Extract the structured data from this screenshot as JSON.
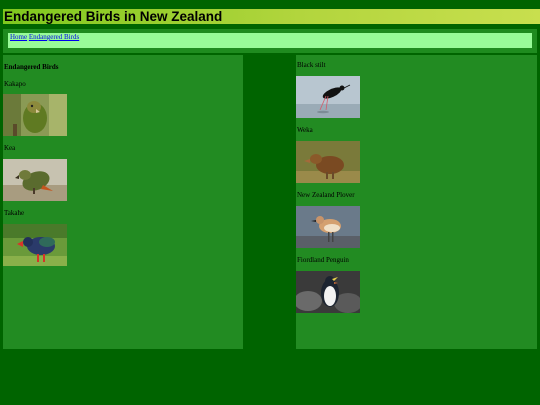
{
  "page": {
    "title": "Endangered Birds in New Zealand"
  },
  "breadcrumb": {
    "home": "Home",
    "current": "Endangered Birds"
  },
  "left_panel": {
    "heading": "Endangered Birds",
    "birds": [
      {
        "name": "Kakapo",
        "icon": "kakapo-photo"
      },
      {
        "name": "Kea",
        "icon": "kea-photo"
      },
      {
        "name": "Takahe",
        "icon": "takahe-photo"
      }
    ]
  },
  "right_panel": {
    "birds": [
      {
        "name": "Black stilt",
        "icon": "black-stilt-photo"
      },
      {
        "name": "Weka",
        "icon": "weka-photo"
      },
      {
        "name": "New Zealand Plover",
        "icon": "nz-plover-photo"
      },
      {
        "name": "Fiordland Penguin",
        "icon": "fiordland-penguin-photo"
      }
    ]
  },
  "colors": {
    "page_bg": "#006400",
    "panel_bg": "#228b22",
    "breadcrumb_bg": "#98fb98",
    "header_gradient_start": "#7ec81e",
    "header_gradient_end": "#c8df4e"
  }
}
